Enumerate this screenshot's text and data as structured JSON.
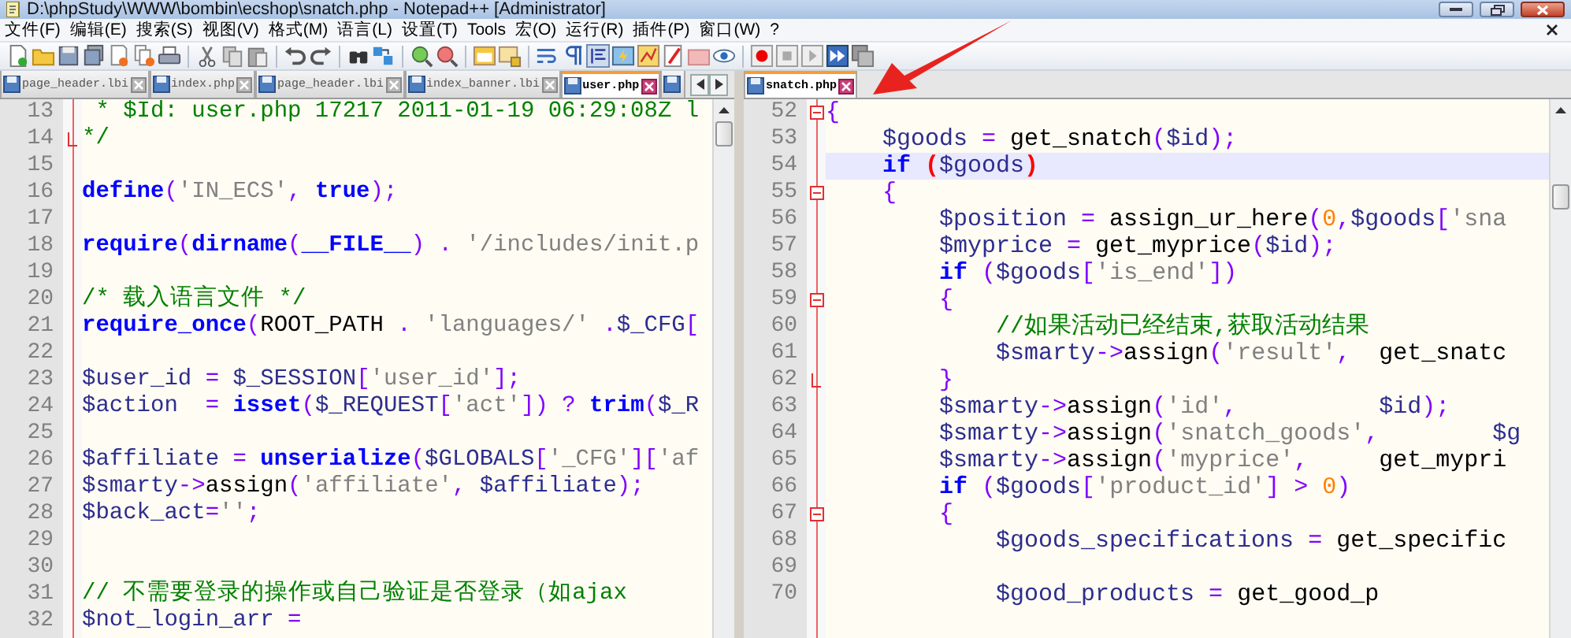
{
  "window": {
    "title": "D:\\phpStudy\\WWW\\bombin\\ecshop\\snatch.php - Notepad++ [Administrator]"
  },
  "menu": [
    "文件(F)",
    "编辑(E)",
    "搜索(S)",
    "视图(V)",
    "格式(M)",
    "语言(L)",
    "设置(T)",
    "Tools",
    "宏(O)",
    "运行(R)",
    "插件(P)",
    "窗口(W)",
    "?"
  ],
  "panes": [
    {
      "tabs": [
        {
          "label": "page_header.lbi",
          "selected": false
        },
        {
          "label": "index.php",
          "selected": false
        },
        {
          "label": "page_header.lbi",
          "selected": false
        },
        {
          "label": "index_banner.lbi",
          "selected": false
        },
        {
          "label": "user.php",
          "selected": true
        },
        {
          "selected": false
        }
      ],
      "lines": [
        {
          "number": "13",
          "current": false,
          "tokens": [
            {
              "kind": "com",
              "text": " * $Id: user.php 17217 2011-01-19 06:29:08Z l"
            }
          ]
        },
        {
          "number": "14",
          "current": false,
          "kind": "fold_end",
          "tokens": [
            {
              "kind": "com",
              "text": "*/"
            }
          ]
        },
        {
          "number": "15",
          "current": false
        },
        {
          "number": "16",
          "current": false,
          "tokens": [
            {
              "kind": "kw",
              "text": "define"
            },
            {
              "kind": "op",
              "text": "("
            },
            {
              "kind": "str",
              "text": "'IN_ECS'"
            },
            {
              "kind": "op",
              "text": ", "
            },
            {
              "kind": "kw",
              "text": "true"
            },
            {
              "kind": "op",
              "text": ");"
            }
          ]
        },
        {
          "number": "17",
          "current": false
        },
        {
          "number": "18",
          "current": false,
          "tokens": [
            {
              "kind": "kw",
              "text": "require"
            },
            {
              "kind": "op",
              "text": "("
            },
            {
              "kind": "kw",
              "text": "dirname"
            },
            {
              "kind": "op",
              "text": "("
            },
            {
              "kind": "kw",
              "text": "__FILE__"
            },
            {
              "kind": "op",
              "text": ") . "
            },
            {
              "kind": "str",
              "text": "'/includes/init.p"
            }
          ]
        },
        {
          "number": "19",
          "current": false
        },
        {
          "number": "20",
          "current": false,
          "tokens": [
            {
              "kind": "com",
              "text": "/* 载入语言文件 */"
            }
          ]
        },
        {
          "number": "21",
          "current": false,
          "tokens": [
            {
              "kind": "kw",
              "text": "require_once"
            },
            {
              "kind": "op",
              "text": "("
            },
            {
              "kind": "plain",
              "text": "ROOT_PATH "
            },
            {
              "kind": "op",
              "text": ". "
            },
            {
              "kind": "str",
              "text": "'languages/'"
            },
            {
              "kind": "op",
              "text": " ."
            },
            {
              "kind": "var",
              "text": "$_CFG"
            },
            {
              "kind": "op",
              "text": "["
            }
          ]
        },
        {
          "number": "22",
          "current": false
        },
        {
          "number": "23",
          "current": false,
          "tokens": [
            {
              "kind": "var",
              "text": "$user_id"
            },
            {
              "kind": "op",
              "text": " = "
            },
            {
              "kind": "var",
              "text": "$_SESSION"
            },
            {
              "kind": "op",
              "text": "["
            },
            {
              "kind": "str",
              "text": "'user_id'"
            },
            {
              "kind": "op",
              "text": "];"
            }
          ]
        },
        {
          "number": "24",
          "current": false,
          "tokens": [
            {
              "kind": "var",
              "text": "$action"
            },
            {
              "kind": "op",
              "text": "  = "
            },
            {
              "kind": "kw",
              "text": "isset"
            },
            {
              "kind": "op",
              "text": "("
            },
            {
              "kind": "var",
              "text": "$_REQUEST"
            },
            {
              "kind": "op",
              "text": "["
            },
            {
              "kind": "str",
              "text": "'act'"
            },
            {
              "kind": "op",
              "text": "]) ? "
            },
            {
              "kind": "kw",
              "text": "trim"
            },
            {
              "kind": "op",
              "text": "("
            },
            {
              "kind": "var",
              "text": "$_R"
            }
          ]
        },
        {
          "number": "25",
          "current": false
        },
        {
          "number": "26",
          "current": false,
          "tokens": [
            {
              "kind": "var",
              "text": "$affiliate"
            },
            {
              "kind": "op",
              "text": " = "
            },
            {
              "kind": "kw",
              "text": "unserialize"
            },
            {
              "kind": "op",
              "text": "("
            },
            {
              "kind": "var",
              "text": "$GLOBALS"
            },
            {
              "kind": "op",
              "text": "["
            },
            {
              "kind": "str",
              "text": "'_CFG'"
            },
            {
              "kind": "op",
              "text": "]["
            },
            {
              "kind": "str",
              "text": "'af"
            }
          ]
        },
        {
          "number": "27",
          "current": false,
          "tokens": [
            {
              "kind": "var",
              "text": "$smarty"
            },
            {
              "kind": "op",
              "text": "->"
            },
            {
              "kind": "plain",
              "text": "assign"
            },
            {
              "kind": "op",
              "text": "("
            },
            {
              "kind": "str",
              "text": "'affiliate'"
            },
            {
              "kind": "op",
              "text": ", "
            },
            {
              "kind": "var",
              "text": "$affiliate"
            },
            {
              "kind": "op",
              "text": ");"
            }
          ]
        },
        {
          "number": "28",
          "current": false,
          "tokens": [
            {
              "kind": "var",
              "text": "$back_act"
            },
            {
              "kind": "op",
              "text": "="
            },
            {
              "kind": "str",
              "text": "''"
            },
            {
              "kind": "op",
              "text": ";"
            }
          ]
        },
        {
          "number": "29",
          "current": false
        },
        {
          "number": "30",
          "current": false
        },
        {
          "number": "31",
          "current": false,
          "tokens": [
            {
              "kind": "com",
              "text": "// 不需要登录的操作或自己验证是否登录（如ajax"
            }
          ]
        },
        {
          "number": "32",
          "current": false,
          "tokens": [
            {
              "kind": "var",
              "text": "$not_login_arr"
            },
            {
              "kind": "op",
              "text": " ="
            }
          ]
        }
      ]
    },
    {
      "tabs": [
        {
          "label": "snatch.php",
          "selected": true
        }
      ],
      "lines": [
        {
          "number": "52",
          "current": false,
          "kind": "fold_start",
          "tokens": [
            {
              "kind": "op",
              "text": "{"
            }
          ]
        },
        {
          "number": "53",
          "current": false,
          "tokens": [
            {
              "kind": "var",
              "text": "    $goods"
            },
            {
              "kind": "op",
              "text": " = "
            },
            {
              "kind": "plain",
              "text": "get_snatch"
            },
            {
              "kind": "op",
              "text": "("
            },
            {
              "kind": "var",
              "text": "$id"
            },
            {
              "kind": "op",
              "text": ");"
            }
          ]
        },
        {
          "number": "54",
          "current": true,
          "tokens": [
            {
              "kind": "kw",
              "text": "    if"
            },
            {
              "kind": "brace",
              "text": " ("
            },
            {
              "kind": "var",
              "text": "$goods"
            },
            {
              "kind": "brace",
              "text": ")"
            }
          ]
        },
        {
          "number": "55",
          "current": false,
          "kind": "fold_start",
          "tokens": [
            {
              "kind": "op",
              "text": "    {"
            }
          ]
        },
        {
          "number": "56",
          "current": false,
          "tokens": [
            {
              "kind": "var",
              "text": "        $position"
            },
            {
              "kind": "op",
              "text": " = "
            },
            {
              "kind": "plain",
              "text": "assign_ur_here"
            },
            {
              "kind": "op",
              "text": "("
            },
            {
              "kind": "num",
              "text": "0"
            },
            {
              "kind": "op",
              "text": ","
            },
            {
              "kind": "var",
              "text": "$goods"
            },
            {
              "kind": "op",
              "text": "["
            },
            {
              "kind": "str",
              "text": "'sna"
            }
          ]
        },
        {
          "number": "57",
          "current": false,
          "tokens": [
            {
              "kind": "var",
              "text": "        $myprice"
            },
            {
              "kind": "op",
              "text": " = "
            },
            {
              "kind": "plain",
              "text": "get_myprice"
            },
            {
              "kind": "op",
              "text": "("
            },
            {
              "kind": "var",
              "text": "$id"
            },
            {
              "kind": "op",
              "text": ");"
            }
          ]
        },
        {
          "number": "58",
          "current": false,
          "tokens": [
            {
              "kind": "kw",
              "text": "        if"
            },
            {
              "kind": "op",
              "text": " ("
            },
            {
              "kind": "var",
              "text": "$goods"
            },
            {
              "kind": "op",
              "text": "["
            },
            {
              "kind": "str",
              "text": "'is_end'"
            },
            {
              "kind": "op",
              "text": "])"
            }
          ]
        },
        {
          "number": "59",
          "current": false,
          "kind": "fold_start",
          "tokens": [
            {
              "kind": "op",
              "text": "        {"
            }
          ]
        },
        {
          "number": "60",
          "current": false,
          "tokens": [
            {
              "kind": "com",
              "text": "            //如果活动已经结束,获取活动结果"
            }
          ]
        },
        {
          "number": "61",
          "current": false,
          "tokens": [
            {
              "kind": "var",
              "text": "            $smarty"
            },
            {
              "kind": "op",
              "text": "->"
            },
            {
              "kind": "plain",
              "text": "assign"
            },
            {
              "kind": "op",
              "text": "("
            },
            {
              "kind": "str",
              "text": "'result'"
            },
            {
              "kind": "op",
              "text": ",  "
            },
            {
              "kind": "plain",
              "text": "get_snatc"
            }
          ]
        },
        {
          "number": "62",
          "current": false,
          "kind": "fold_end",
          "tokens": [
            {
              "kind": "op",
              "text": "        }"
            }
          ]
        },
        {
          "number": "63",
          "current": false,
          "tokens": [
            {
              "kind": "var",
              "text": "        $smarty"
            },
            {
              "kind": "op",
              "text": "->"
            },
            {
              "kind": "plain",
              "text": "assign"
            },
            {
              "kind": "op",
              "text": "("
            },
            {
              "kind": "str",
              "text": "'id'"
            },
            {
              "kind": "op",
              "text": ",          "
            },
            {
              "kind": "var",
              "text": "$id"
            },
            {
              "kind": "op",
              "text": ");"
            }
          ]
        },
        {
          "number": "64",
          "current": false,
          "tokens": [
            {
              "kind": "var",
              "text": "        $smarty"
            },
            {
              "kind": "op",
              "text": "->"
            },
            {
              "kind": "plain",
              "text": "assign"
            },
            {
              "kind": "op",
              "text": "("
            },
            {
              "kind": "str",
              "text": "'snatch_goods'"
            },
            {
              "kind": "op",
              "text": ",        "
            },
            {
              "kind": "var",
              "text": "$g"
            }
          ]
        },
        {
          "number": "65",
          "current": false,
          "tokens": [
            {
              "kind": "var",
              "text": "        $smarty"
            },
            {
              "kind": "op",
              "text": "->"
            },
            {
              "kind": "plain",
              "text": "assign"
            },
            {
              "kind": "op",
              "text": "("
            },
            {
              "kind": "str",
              "text": "'myprice'"
            },
            {
              "kind": "op",
              "text": ",     "
            },
            {
              "kind": "plain",
              "text": "get_mypri"
            }
          ]
        },
        {
          "number": "66",
          "current": false,
          "tokens": [
            {
              "kind": "kw",
              "text": "        if"
            },
            {
              "kind": "op",
              "text": " ("
            },
            {
              "kind": "var",
              "text": "$goods"
            },
            {
              "kind": "op",
              "text": "["
            },
            {
              "kind": "str",
              "text": "'product_id'"
            },
            {
              "kind": "op",
              "text": "] > "
            },
            {
              "kind": "num",
              "text": "0"
            },
            {
              "kind": "op",
              "text": ")"
            }
          ]
        },
        {
          "number": "67",
          "current": false,
          "kind": "fold_start",
          "tokens": [
            {
              "kind": "op",
              "text": "        {"
            }
          ]
        },
        {
          "number": "68",
          "current": false,
          "tokens": [
            {
              "kind": "var",
              "text": "            $goods_specifications"
            },
            {
              "kind": "op",
              "text": " = "
            },
            {
              "kind": "plain",
              "text": "get_specific"
            }
          ]
        },
        {
          "number": "69",
          "current": false
        },
        {
          "number": "70",
          "current": false,
          "tokens": [
            {
              "kind": "var",
              "text": "            $good_products"
            },
            {
              "kind": "op",
              "text": " = "
            },
            {
              "kind": "plain",
              "text": "get_good_p"
            }
          ]
        }
      ]
    }
  ]
}
